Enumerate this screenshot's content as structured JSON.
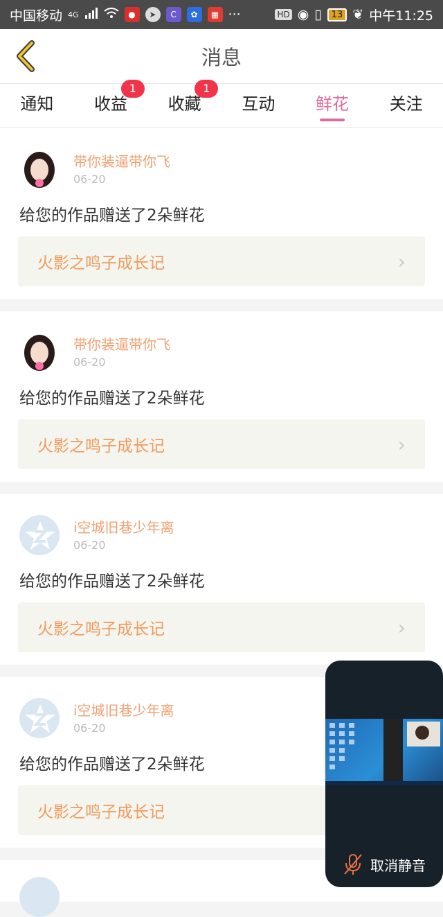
{
  "status_bar": {
    "carrier": "中国移动",
    "network": "4G",
    "more": "···",
    "hd": "HD",
    "battery": "13",
    "time": "中午11:25"
  },
  "nav": {
    "title": "消息"
  },
  "tabs": [
    {
      "label": "通知",
      "badge": ""
    },
    {
      "label": "收益",
      "badge": "1"
    },
    {
      "label": "收藏",
      "badge": "1"
    },
    {
      "label": "互动",
      "badge": ""
    },
    {
      "label": "鲜花",
      "badge": ""
    },
    {
      "label": "关注",
      "badge": ""
    }
  ],
  "active_tab": "鲜花",
  "messages": [
    {
      "username": "带你装逼带你飞",
      "date": "06-20",
      "text": "给您的作品赠送了2朵鲜花",
      "work": "火影之鸣子成长记",
      "avatar": "girl-avatar"
    },
    {
      "username": "带你装逼带你飞",
      "date": "06-20",
      "text": "给您的作品赠送了2朵鲜花",
      "work": "火影之鸣子成长记",
      "avatar": "girl-avatar"
    },
    {
      "username": "i空城旧巷少年离",
      "date": "06-20",
      "text": "给您的作品赠送了2朵鲜花",
      "work": "火影之鸣子成长记",
      "avatar": "qq-star-avatar"
    },
    {
      "username": "i空城旧巷少年离",
      "date": "06-20",
      "text": "给您的作品赠送了2朵鲜花",
      "work": "火影之鸣子成长记",
      "avatar": "qq-star-avatar"
    }
  ],
  "floating_window": {
    "unmute_label": "取消静音"
  },
  "colors": {
    "accent": "#e06a9d",
    "username": "#f0a070",
    "work_title": "#f09a5c",
    "badge": "#f2344a"
  }
}
